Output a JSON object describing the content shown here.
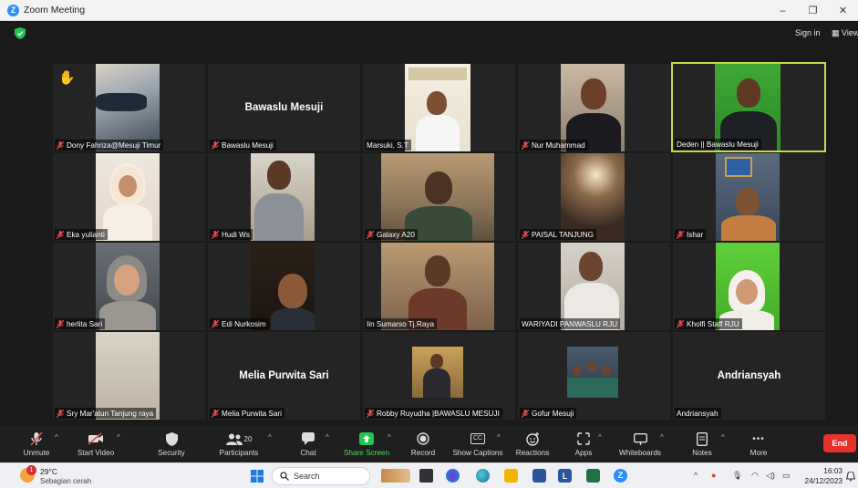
{
  "window": {
    "title": "Zoom Meeting",
    "minimize": "–",
    "maximize": "❐",
    "close": "✕"
  },
  "topbar": {
    "signin": "Sign in",
    "view": "View"
  },
  "tiles": [
    {
      "name": "Dony Fahriza@Mesuji Timur",
      "muted": true
    },
    {
      "name": "Bawaslu Mesuji",
      "muted": true,
      "center_label": "Bawaslu Mesuji"
    },
    {
      "name": "Marsuki, S.T",
      "muted": false
    },
    {
      "name": "Nur Muhammad",
      "muted": true
    },
    {
      "name": "Deden || Bawaslu Mesuji",
      "muted": false
    },
    {
      "name": "Eka yulianti",
      "muted": true
    },
    {
      "name": "Hudi Ws",
      "muted": true
    },
    {
      "name": "Galaxy A20",
      "muted": true
    },
    {
      "name": "PAISAL TANJUNG",
      "muted": true
    },
    {
      "name": "Ishar",
      "muted": true
    },
    {
      "name": "herlita Sari",
      "muted": true
    },
    {
      "name": "Edi Nurkosim",
      "muted": true
    },
    {
      "name": "Iin Sumarso Tj.Raya",
      "muted": false
    },
    {
      "name": "WARIYADI PANWASLU RJU",
      "muted": false
    },
    {
      "name": "Kholfi Staff RJU",
      "muted": true
    },
    {
      "name": "Sry Mar'atun Tanjung raya",
      "muted": true
    },
    {
      "name": "Melia Purwita Sari",
      "muted": true,
      "center_label": "Melia Purwita Sari"
    },
    {
      "name": "Robby Ruyudha |BAWASLU MESUJI",
      "muted": true
    },
    {
      "name": "Gofur Mesuji",
      "muted": true
    },
    {
      "name": "Andriansyah",
      "muted": false,
      "center_label": "Andriansyah"
    }
  ],
  "toolbar": {
    "unmute": "Unmute",
    "start_video": "Start Video",
    "security": "Security",
    "participants": "Participants",
    "participants_count": "20",
    "chat": "Chat",
    "share_screen": "Share Screen",
    "record": "Record",
    "show_captions": "Show Captions",
    "reactions": "Reactions",
    "apps": "Apps",
    "whiteboards": "Whiteboards",
    "notes": "Notes",
    "more": "More",
    "end": "End",
    "captions_icon": "CC",
    "more_icon": "•••"
  },
  "taskbar": {
    "temperature": "29°C",
    "condition": "Sebagian cerah",
    "weather_badge": "1",
    "search_label": "Search",
    "time": "16:03",
    "date": "24/12/2023",
    "app_l": "L",
    "app_z": "Z"
  },
  "colors": {
    "meeting_bg": "#1a1a1a",
    "tile_bg": "#242424",
    "active_border": "#c8d84b",
    "share_green": "#4cd964",
    "end_red": "#e5322d",
    "zoom_blue": "#2d8cff"
  }
}
